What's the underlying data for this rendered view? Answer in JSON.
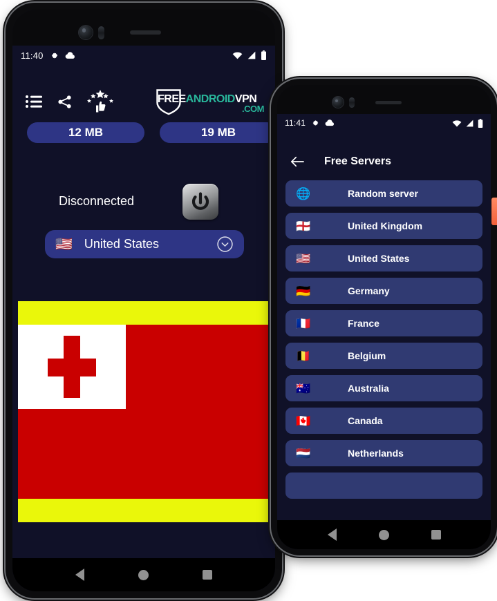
{
  "phone1": {
    "statusbar": {
      "time": "11:40",
      "icons_left": [
        "gear-icon",
        "cloud-icon"
      ],
      "icons_right": [
        "wifi-icon",
        "signal-icon",
        "battery-icon"
      ]
    },
    "toolbar": {
      "buttons": [
        {
          "name": "list-button",
          "icon": "list-icon"
        },
        {
          "name": "share-button",
          "icon": "share-icon"
        },
        {
          "name": "rate-button",
          "icon": "rate-stars-thumbsup-icon"
        }
      ]
    },
    "logo": {
      "part1": "FREE",
      "part2": "ANDROID",
      "part3": "VPN",
      "part4": ".COM",
      "shield_icon": "shield-icon",
      "color_white": "#ffffff",
      "color_teal": "#29b79b"
    },
    "stats": {
      "download": "12 MB",
      "upload": "19 MB"
    },
    "connection": {
      "status": "Disconnected",
      "power_icon": "power-icon"
    },
    "server_selector": {
      "flag": "🇺🇸",
      "label": "United States",
      "chevron_icon": "chevron-down-circle-icon"
    },
    "ad_banner": {
      "stripe_color": "#eaf70a",
      "flag_name": "tonga-flag",
      "flag_red": "#c90000",
      "flag_white": "#ffffff"
    },
    "navbar": {
      "back": "back-icon",
      "home": "home-icon",
      "recents": "recents-icon"
    }
  },
  "phone2": {
    "statusbar": {
      "time": "11:41",
      "icons_left": [
        "gear-icon",
        "cloud-icon"
      ],
      "icons_right": [
        "wifi-icon",
        "signal-icon",
        "battery-icon"
      ]
    },
    "appbar": {
      "back_icon": "arrow-left-icon",
      "title": "Free Servers"
    },
    "servers": [
      {
        "flag": "🌐",
        "name": "Random server"
      },
      {
        "flag": "🏴󠁧󠁢󠁥󠁮󠁧󠁿",
        "name": "United Kingdom"
      },
      {
        "flag": "🇺🇸",
        "name": "United States"
      },
      {
        "flag": "🇩🇪",
        "name": "Germany"
      },
      {
        "flag": "🇫🇷",
        "name": "France"
      },
      {
        "flag": "🇧🇪",
        "name": "Belgium"
      },
      {
        "flag": "🇦🇺",
        "name": "Australia"
      },
      {
        "flag": "🇨🇦",
        "name": "Canada"
      },
      {
        "flag": "🇳🇱",
        "name": "Netherlands"
      }
    ],
    "navbar": {
      "back": "back-icon",
      "home": "home-icon",
      "recents": "recents-icon"
    }
  },
  "theme": {
    "background": "#101128",
    "pill": "#2e3585",
    "list_item": "#303a72",
    "accent_teal": "#29b79b",
    "side_tab": "#f2603a"
  }
}
